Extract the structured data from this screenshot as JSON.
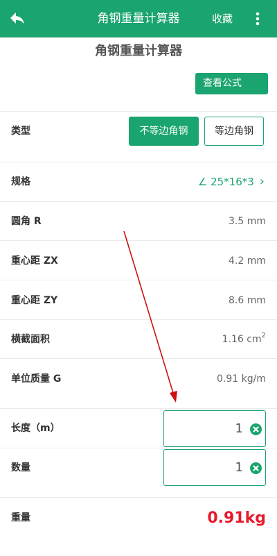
{
  "appbar": {
    "title": "角钢重量计算器",
    "favorite_label": "收藏",
    "back_icon": "back-arrow-icon",
    "more_icon": "more-vertical-icon"
  },
  "page": {
    "title": "角钢重量计算器",
    "formula_button": "查看公式"
  },
  "type": {
    "label": "类型",
    "options": [
      "不等边角钢",
      "等边角钢"
    ],
    "selected": "不等边角钢"
  },
  "spec": {
    "label": "规格",
    "value": "∠ 25*16*3",
    "chevron": "›"
  },
  "fillet": {
    "label": "圆角 R",
    "value": "3.5 mm"
  },
  "zx": {
    "label": "重心距 ZX",
    "value": "4.2 mm"
  },
  "zy": {
    "label": "重心距 ZY",
    "value": "8.6 mm"
  },
  "area": {
    "label": "横截面积",
    "value": "1.16 cm",
    "unit_sup": "2"
  },
  "unit_mass": {
    "label": "单位质量 G",
    "value": "0.91 kg/m"
  },
  "length": {
    "label": "长度（m）",
    "value": "1"
  },
  "quantity": {
    "label": "数量",
    "value": "1"
  },
  "weight": {
    "label": "重量",
    "value": "0.91kg"
  },
  "colors": {
    "accent": "#1aa46f",
    "result": "#e8192c",
    "annotation": "#cc1111"
  }
}
